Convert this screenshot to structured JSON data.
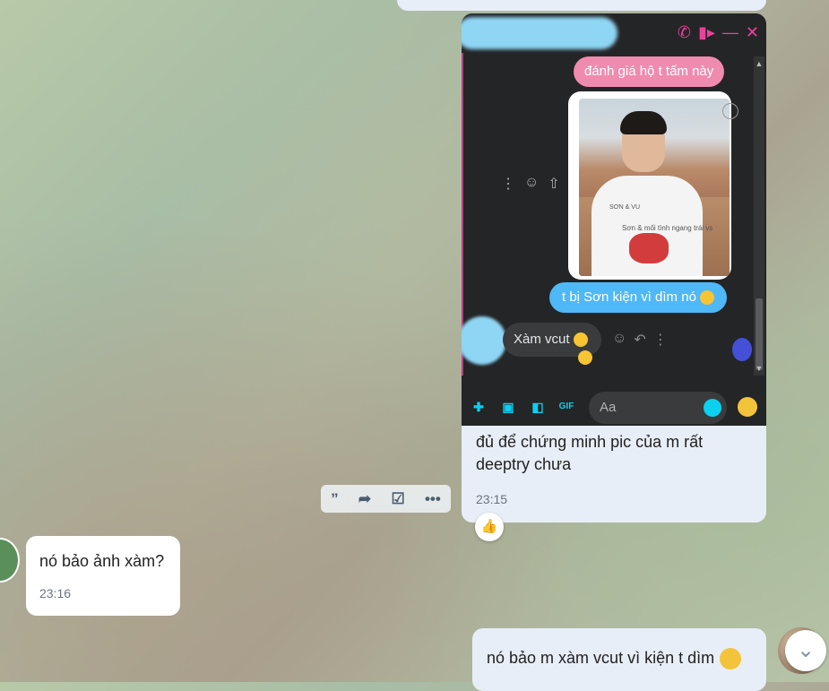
{
  "messenger_screenshot": {
    "header_icons": [
      "phone-icon",
      "video-icon",
      "minimize-icon",
      "close-icon"
    ],
    "messages": {
      "pink": "đánh giá hộ t tấm này",
      "photo_shirt_brand": "SƠN & VU",
      "photo_shirt_caption": "Sơn & mối tình ngang trái vs",
      "blue": "t bị Sơn kiện vì dìm nó",
      "dark": "Xàm vcut"
    },
    "composer": {
      "placeholder": "Aa",
      "icons": [
        "plus-icon",
        "image-icon",
        "sticker-icon",
        "gif-icon",
        "emoji-icon"
      ],
      "gif_label": "GIF"
    },
    "accent": "#0bd0f0"
  },
  "outgoing_caption": {
    "text": "đủ để chứng minh pic của m rất deeptry chưa",
    "time": "23:15"
  },
  "hover_toolbar": {
    "items": [
      "quote-icon",
      "forward-icon",
      "task-icon",
      "more-icon"
    ]
  },
  "incoming": {
    "text": "nó bảo ảnh xàm?",
    "time": "23:16"
  },
  "outgoing_last": {
    "text": "nó bảo m xàm vcut vì kiện t dìm"
  },
  "colors": {
    "bubble_out": "#e8eef7",
    "bubble_in": "#ffffff",
    "messenger_pink": "#f08bb0",
    "messenger_blue": "#4fb8f7"
  }
}
